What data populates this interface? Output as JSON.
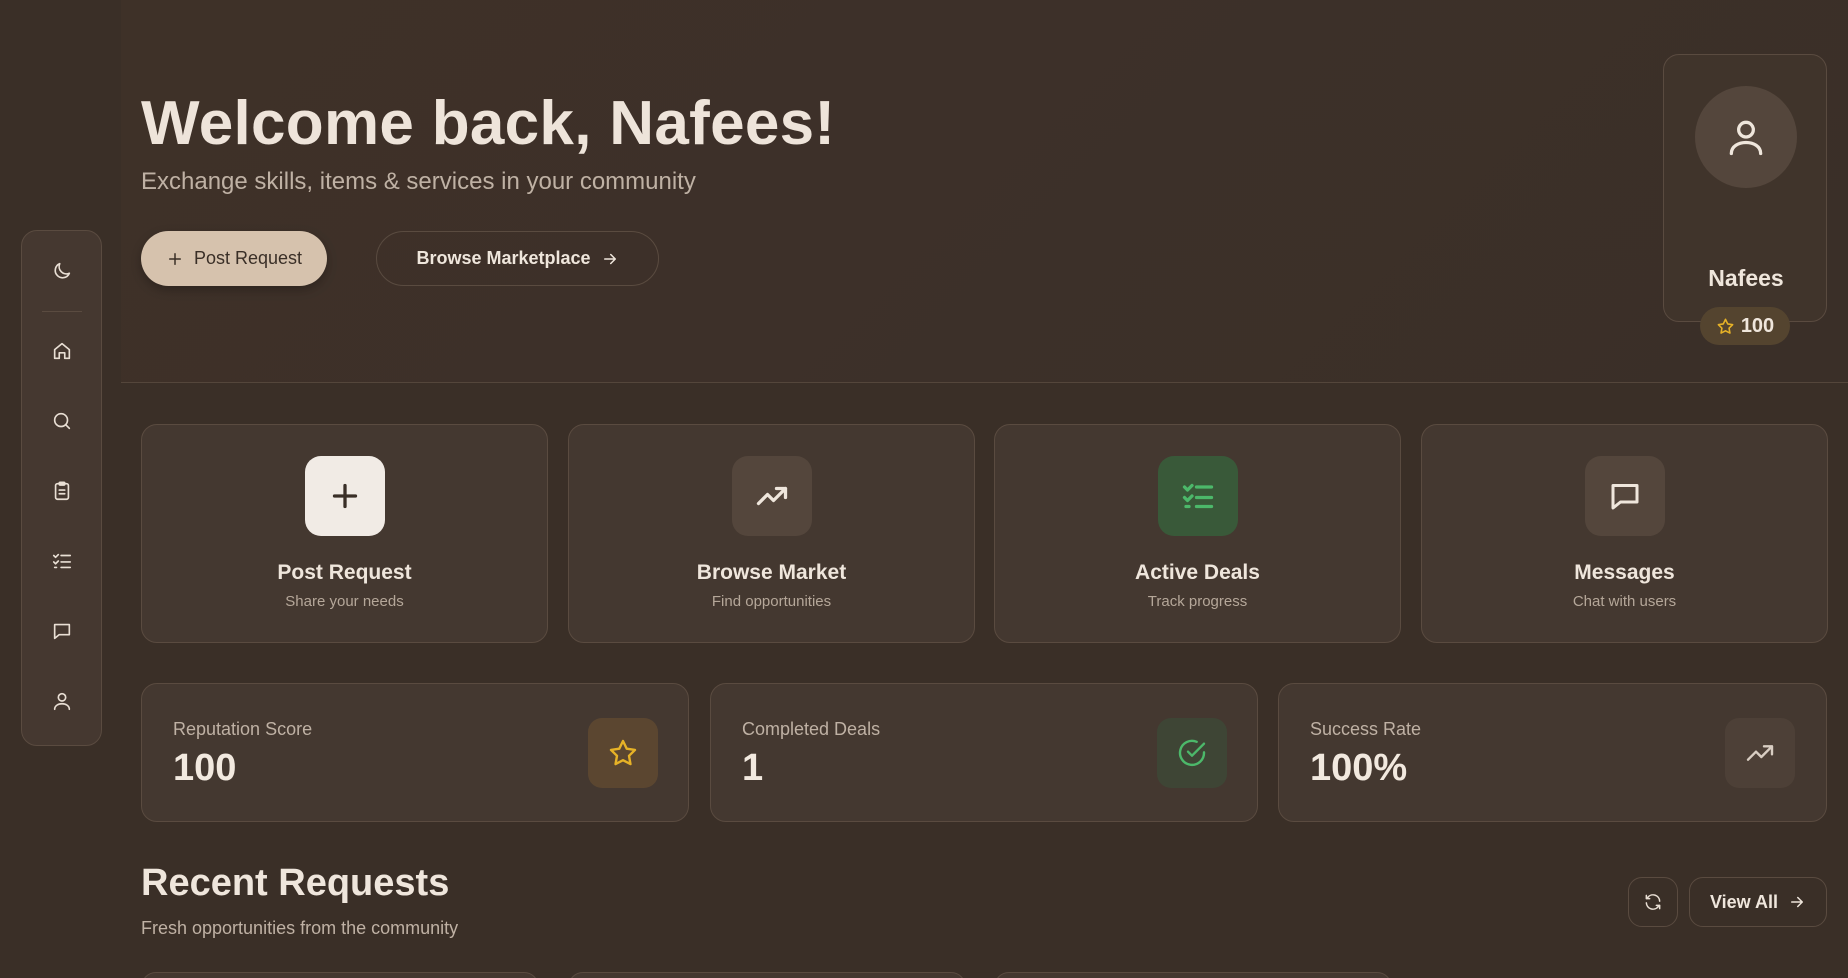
{
  "hero": {
    "title": "Welcome back, Nafees!",
    "subtitle": "Exchange skills, items & services in your community",
    "primary_button": "Post Request",
    "secondary_button": "Browse Marketplace"
  },
  "profile": {
    "name": "Nafees",
    "reputation": "100"
  },
  "sidebar": {
    "items": [
      {
        "name": "theme-toggle",
        "icon": "moon-icon"
      },
      {
        "name": "home",
        "icon": "home-icon"
      },
      {
        "name": "search",
        "icon": "search-icon"
      },
      {
        "name": "requests",
        "icon": "clipboard-icon"
      },
      {
        "name": "deals",
        "icon": "checklist-icon"
      },
      {
        "name": "messages",
        "icon": "chat-icon"
      },
      {
        "name": "profile",
        "icon": "user-icon"
      }
    ]
  },
  "actions": [
    {
      "title": "Post Request",
      "subtitle": "Share your needs",
      "icon": "plus-icon"
    },
    {
      "title": "Browse Market",
      "subtitle": "Find opportunities",
      "icon": "trending-up-icon"
    },
    {
      "title": "Active Deals",
      "subtitle": "Track progress",
      "icon": "checklist-icon"
    },
    {
      "title": "Messages",
      "subtitle": "Chat with users",
      "icon": "chat-icon"
    }
  ],
  "stats": [
    {
      "label": "Reputation Score",
      "value": "100",
      "icon": "star-icon"
    },
    {
      "label": "Completed Deals",
      "value": "1",
      "icon": "check-circle-icon"
    },
    {
      "label": "Success Rate",
      "value": "100%",
      "icon": "trending-up-icon"
    }
  ],
  "recent": {
    "title": "Recent Requests",
    "subtitle": "Fresh opportunities from the community",
    "view_all": "View All"
  },
  "colors": {
    "background": "#3a2f27",
    "card": "#443830",
    "accent_primary": "#d6c2ad",
    "star": "#e6b227",
    "success": "#4cb86a"
  }
}
